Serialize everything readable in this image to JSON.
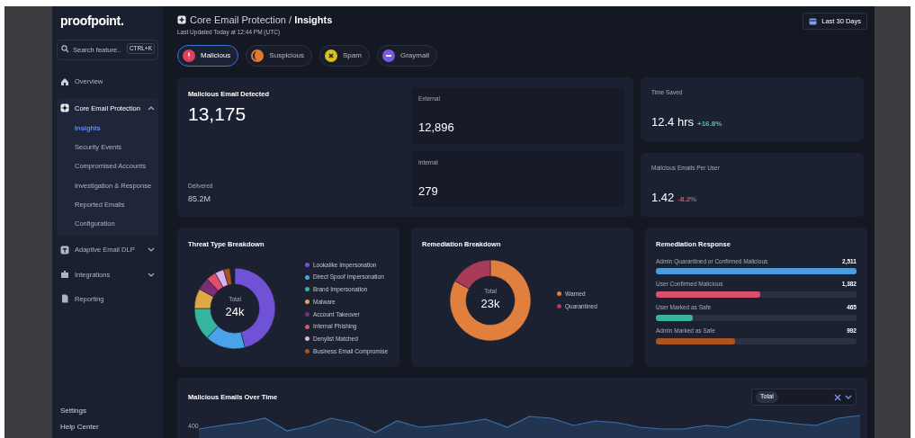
{
  "brand": "proofpoint.",
  "search": {
    "placeholder": "Search feature...",
    "shortcut": "CTRL+K"
  },
  "nav": [
    {
      "kind": "link",
      "label": "Overview"
    },
    {
      "kind": "group",
      "label": "Core Email Protection",
      "expanded": true,
      "children": [
        {
          "label": "Insights",
          "selected": true
        },
        {
          "label": "Security Events",
          "selected": false
        },
        {
          "label": "Compromised Accounts",
          "selected": false
        },
        {
          "label": "Investigation & Response",
          "selected": false
        },
        {
          "label": "Reported Emails",
          "selected": false
        },
        {
          "label": "Configuration",
          "selected": false
        }
      ]
    },
    {
      "kind": "group",
      "label": "Adaptive Email DLP",
      "expanded": false
    },
    {
      "kind": "group",
      "label": "Integrations",
      "expanded": false
    },
    {
      "kind": "link",
      "label": "Reporting"
    }
  ],
  "footer_links": [
    "Settings",
    "Help Center"
  ],
  "breadcrumb": {
    "section": "Core Email Protection",
    "separator": "/",
    "page": "Insights"
  },
  "updated": "Last Updated Today at 12:44 PM (UTC)",
  "date_range": "Last 30 Days",
  "categories": [
    {
      "label": "Malicious",
      "selected": true,
      "color": "#e0405a"
    },
    {
      "label": "Suspicious",
      "selected": false,
      "color": "#e07a30"
    },
    {
      "label": "Spam",
      "selected": false,
      "color": "#d8c020"
    },
    {
      "label": "Graymail",
      "selected": false,
      "color": "#7a5ae0"
    }
  ],
  "detected": {
    "title": "Malicious Email Detected",
    "value": "13,175",
    "sub_label": "Delivered",
    "sub_value": "85.2M",
    "breakdown": [
      {
        "label": "External",
        "value": "12,896"
      },
      {
        "label": "Internal",
        "value": "279"
      }
    ]
  },
  "kpis": [
    {
      "label": "Time Saved",
      "value": "12.4 hrs",
      "change": "+16.8%",
      "color": "#3ec9a0"
    },
    {
      "label": "Malicious Emails Per User",
      "value": "1.42",
      "change": "-8.2%",
      "color": "#e0506e"
    }
  ],
  "threat": {
    "title": "Threat Type Breakdown",
    "total_label": "Total",
    "total": "24k",
    "legend": [
      {
        "label": "Lookalike Impersonation",
        "color": "#6f52d6"
      },
      {
        "label": "Direct Spoof Impersonation",
        "color": "#4aa3e8"
      },
      {
        "label": "Brand Impersonation",
        "color": "#35b5a0"
      },
      {
        "label": "Malware",
        "color": "#e0a845"
      },
      {
        "label": "Account Takeover",
        "color": "#7a2f72"
      },
      {
        "label": "Internal Phishing",
        "color": "#e0506e"
      },
      {
        "label": "Denylist Matched",
        "color": "#d9b3f0"
      },
      {
        "label": "Business Email Compromise",
        "color": "#a9541e"
      }
    ]
  },
  "remediation": {
    "title": "Remediation Breakdown",
    "total_label": "Total",
    "total": "23k",
    "legend": [
      {
        "label": "Warned",
        "color": "#e07f3e"
      },
      {
        "label": "Quarantined",
        "color": "#a83a5a"
      }
    ]
  },
  "response": {
    "title": "Remediation Response",
    "rows": [
      {
        "label": "Admin Quarantined or Confirmed Malicious",
        "value": "2,511",
        "level": 1.0,
        "color": "#4a9be0"
      },
      {
        "label": "User Confirmed Malicious",
        "value": "1,382",
        "level": 0.52,
        "color": "#d9506e"
      },
      {
        "label": "User Marked as Safe",
        "value": "465",
        "level": 0.185,
        "color": "#35b5a0"
      },
      {
        "label": "Admin Marked as Safe",
        "value": "992",
        "level": 0.395,
        "color": "#a9541e"
      }
    ]
  },
  "over_time": {
    "title": "Malicious Emails Over Time",
    "filter_chip": "Total",
    "y_tick": "400"
  }
}
